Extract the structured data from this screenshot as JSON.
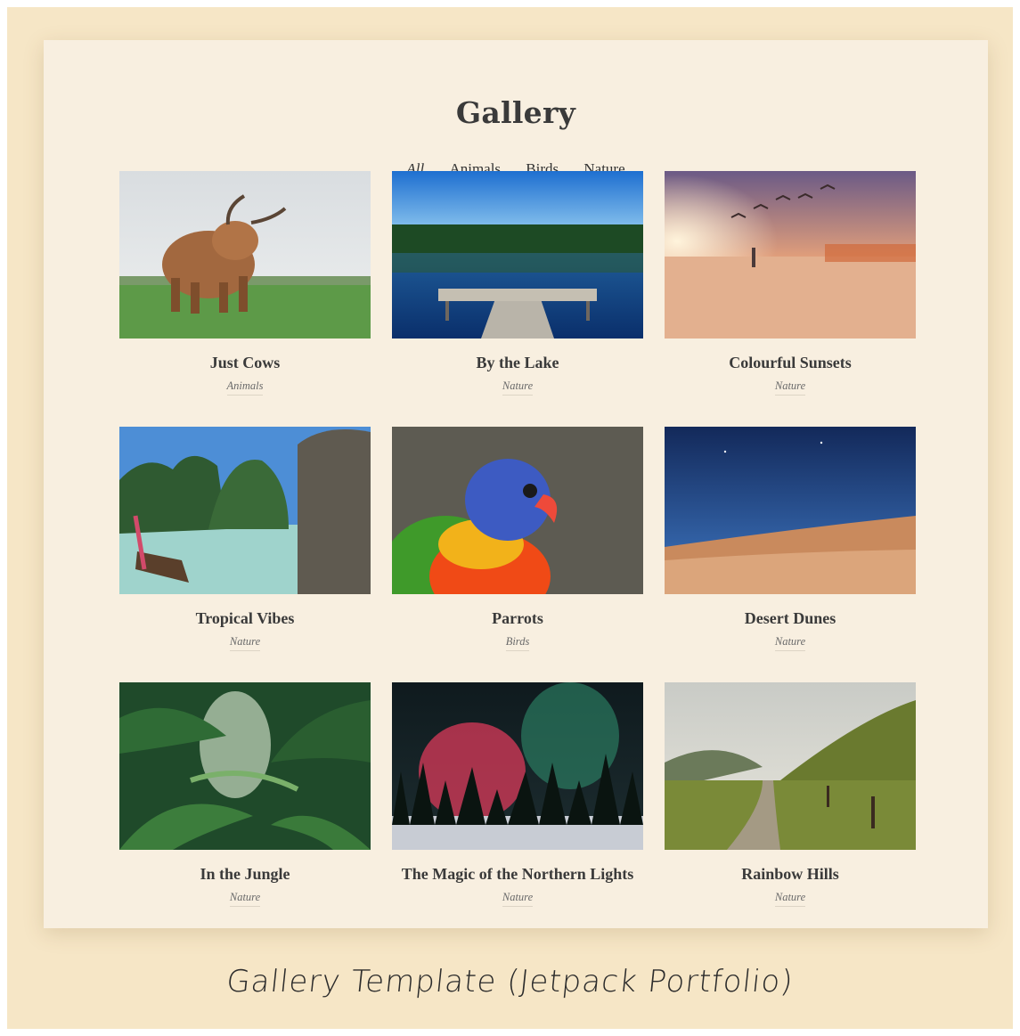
{
  "page_title": "Gallery",
  "filters": [
    {
      "label": "All",
      "active": true
    },
    {
      "label": "Animals",
      "active": false
    },
    {
      "label": "Birds",
      "active": false
    },
    {
      "label": "Nature",
      "active": false
    }
  ],
  "items": [
    {
      "title": "Just Cows",
      "category": "Animals",
      "image": "highland-cow-photo"
    },
    {
      "title": "By the Lake",
      "category": "Nature",
      "image": "lake-dock-photo"
    },
    {
      "title": "Colourful Sunsets",
      "category": "Nature",
      "image": "sunset-beach-photo"
    },
    {
      "title": "Tropical Vibes",
      "category": "Nature",
      "image": "tropical-beach-photo"
    },
    {
      "title": "Parrots",
      "category": "Birds",
      "image": "parrot-photo"
    },
    {
      "title": "Desert Dunes",
      "category": "Nature",
      "image": "desert-dunes-photo"
    },
    {
      "title": "In the Jungle",
      "category": "Nature",
      "image": "jungle-photo"
    },
    {
      "title": "The Magic of the Northern Lights",
      "category": "Nature",
      "image": "northern-lights-photo"
    },
    {
      "title": "Rainbow Hills",
      "category": "Nature",
      "image": "rainbow-hills-photo"
    }
  ],
  "caption": "Gallery Template (Jetpack Portfolio)",
  "colors": {
    "outer_background": "#f6e6c6",
    "card_background": "#f8efe0",
    "text": "#3a3a3a"
  }
}
